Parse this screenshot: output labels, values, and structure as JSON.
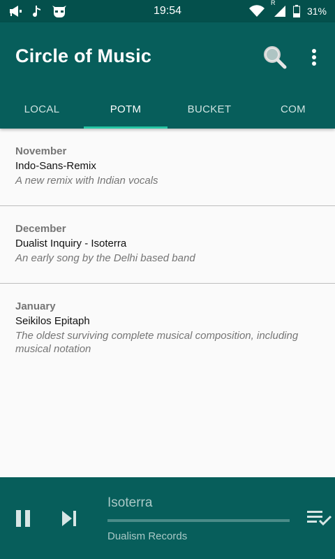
{
  "status_bar": {
    "time": "19:54",
    "battery": "31%",
    "roaming": "R",
    "icons": [
      "megaphone-icon",
      "music-note-icon",
      "cyanogen-mascot-icon",
      "wifi-icon",
      "signal-icon"
    ]
  },
  "app_bar": {
    "title": "Circle of Music",
    "icons": [
      "search-icon",
      "more-vert-icon"
    ]
  },
  "tabs": [
    {
      "label": "LOCAL",
      "active": false
    },
    {
      "label": "POTM",
      "active": true
    },
    {
      "label": "BUCKET",
      "active": false
    },
    {
      "label": "COM",
      "active": false
    }
  ],
  "items": [
    {
      "month": "November",
      "name": "Indo-Sans-Remix",
      "desc": "A new remix with Indian vocals"
    },
    {
      "month": "December",
      "name": "Dualist Inquiry - Isoterra",
      "desc": "An early song by the Delhi based band"
    },
    {
      "month": "January",
      "name": "Seikilos Epitaph",
      "desc": "The oldest surviving complete musical composition, including musical notation"
    }
  ],
  "player": {
    "title": "Isoterra",
    "artist": "Dualism Records",
    "progress": 0,
    "icons": [
      "pause-icon",
      "skip-next-icon",
      "playlist-check-icon"
    ]
  },
  "colors": {
    "primary": "#075e5b",
    "status_bar": "#04504c",
    "accent": "#26c6a4",
    "background": "#fafafa"
  }
}
